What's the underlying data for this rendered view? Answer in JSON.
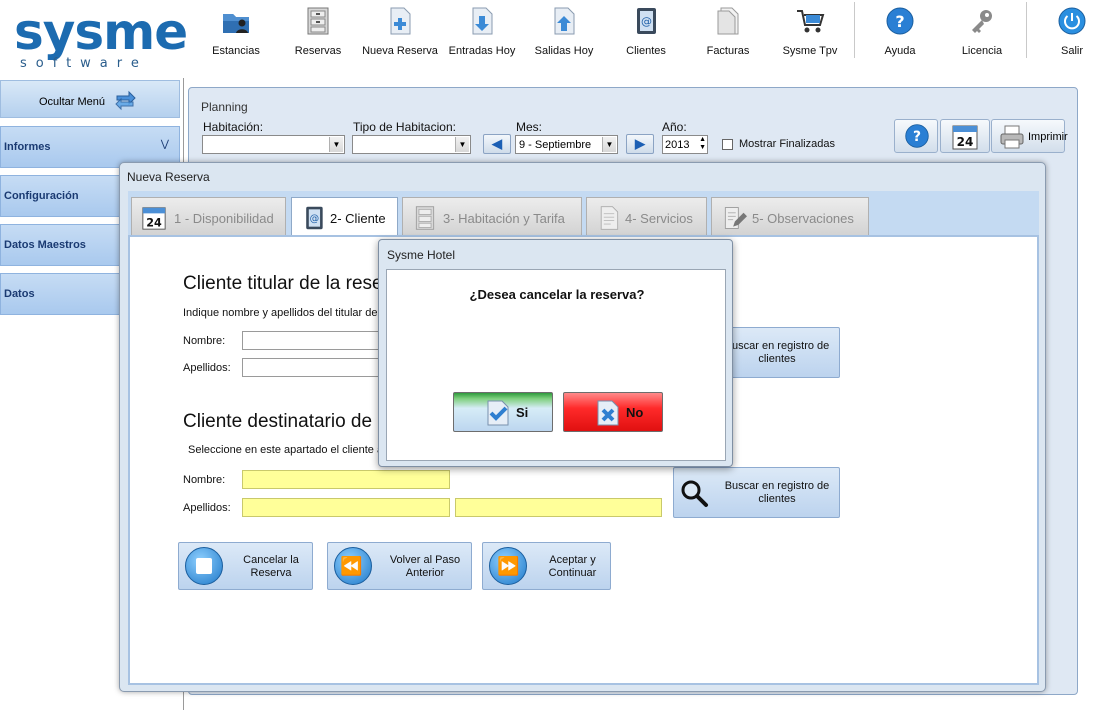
{
  "app": {
    "logo_text": "sysme",
    "logo_subtext": "software"
  },
  "toolbar": {
    "items": [
      {
        "label": "Estancias",
        "icon": "folder-person-icon"
      },
      {
        "label": "Reservas",
        "icon": "cabinet-icon"
      },
      {
        "label": "Nueva Reserva",
        "icon": "new-document-icon"
      },
      {
        "label": "Entradas Hoy",
        "icon": "document-in-icon"
      },
      {
        "label": "Salidas Hoy",
        "icon": "document-out-icon"
      },
      {
        "label": "Clientes",
        "icon": "address-book-icon"
      },
      {
        "label": "Facturas",
        "icon": "invoice-icon"
      },
      {
        "label": "Sysme Tpv",
        "icon": "cart-icon"
      },
      {
        "label": "Ayuda",
        "icon": "help-icon"
      },
      {
        "label": "Licencia",
        "icon": "key-icon"
      },
      {
        "label": "Salir",
        "icon": "power-icon"
      }
    ]
  },
  "sidebar": {
    "toggle_label": "Ocultar Menú",
    "items": [
      {
        "label": "Informes"
      },
      {
        "label": "Configuración"
      },
      {
        "label": "Datos Maestros"
      },
      {
        "label": "Datos"
      }
    ]
  },
  "planning": {
    "title": "Planning",
    "habitacion_label": "Habitación:",
    "habitacion_value": "",
    "tipo_label": "Tipo de Habitacion:",
    "tipo_value": "",
    "mes_label": "Mes:",
    "mes_value": "9  - Septiembre",
    "anio_label": "Año:",
    "anio_value": "2013",
    "mostrar_label": "Mostrar Finalizadas",
    "mostrar_checked": false,
    "print_label": "Imprimir"
  },
  "reserva": {
    "window_title": "Nueva Reserva",
    "tabs": [
      {
        "label": "1 - Disponibilidad",
        "active": false
      },
      {
        "label": "2- Cliente",
        "active": true
      },
      {
        "label": "3- Habitación y Tarifa",
        "active": false
      },
      {
        "label": "4- Servicios",
        "active": false
      },
      {
        "label": "5- Observaciones",
        "active": false
      }
    ],
    "titular": {
      "title": "Cliente titular de la rese",
      "subtitle": "Indique nombre y apellidos del titular de la",
      "nombre_label": "Nombre:",
      "apellidos_label": "Apellidos:",
      "search_label": "Buscar en registro de clientes"
    },
    "destinatario": {
      "title": "Cliente destinatario de l",
      "subtitle": "Seleccione en este apartado el cliente a",
      "nombre_label": "Nombre:",
      "apellidos_label": "Apellidos:",
      "search_label": "Buscar en registro de clientes"
    },
    "actions": {
      "cancel_label": "Cancelar la Reserva",
      "back_label": "Volver al Paso Anterior",
      "accept_label": "Aceptar y Continuar"
    }
  },
  "dialog": {
    "title": "Sysme Hotel",
    "message": "¿Desea cancelar la reserva?",
    "yes_label": "Si",
    "no_label": "No"
  }
}
